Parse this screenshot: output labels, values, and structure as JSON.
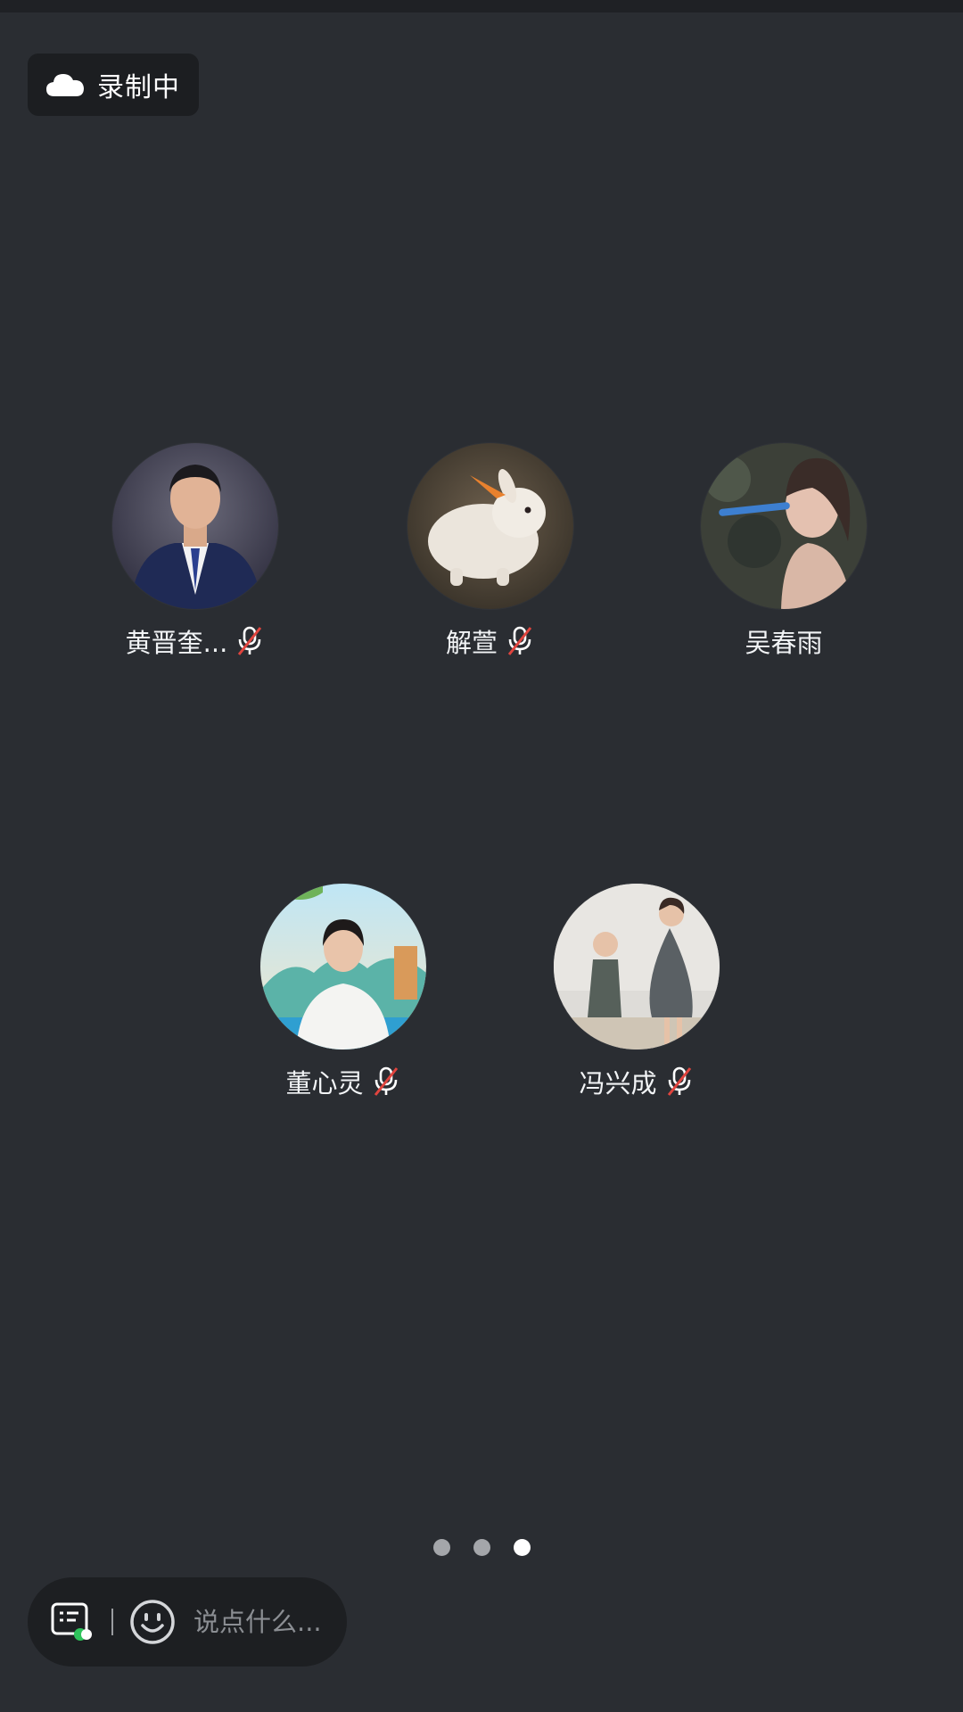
{
  "recording": {
    "label": "录制中",
    "icon": "cloud-icon"
  },
  "participants": [
    {
      "name": "黄晋奎...",
      "muted": true
    },
    {
      "name": "解萱",
      "muted": true
    },
    {
      "name": "吴春雨",
      "muted": false
    },
    {
      "name": "董心灵",
      "muted": true
    },
    {
      "name": "冯兴成",
      "muted": true
    }
  ],
  "pagination": {
    "total": 3,
    "current": 3
  },
  "chat": {
    "placeholder": "说点什么..."
  },
  "colors": {
    "background": "#2a2d32",
    "panel": "#1c1e21",
    "muted_slash": "#e0443e",
    "status_green": "#2fc25b"
  }
}
